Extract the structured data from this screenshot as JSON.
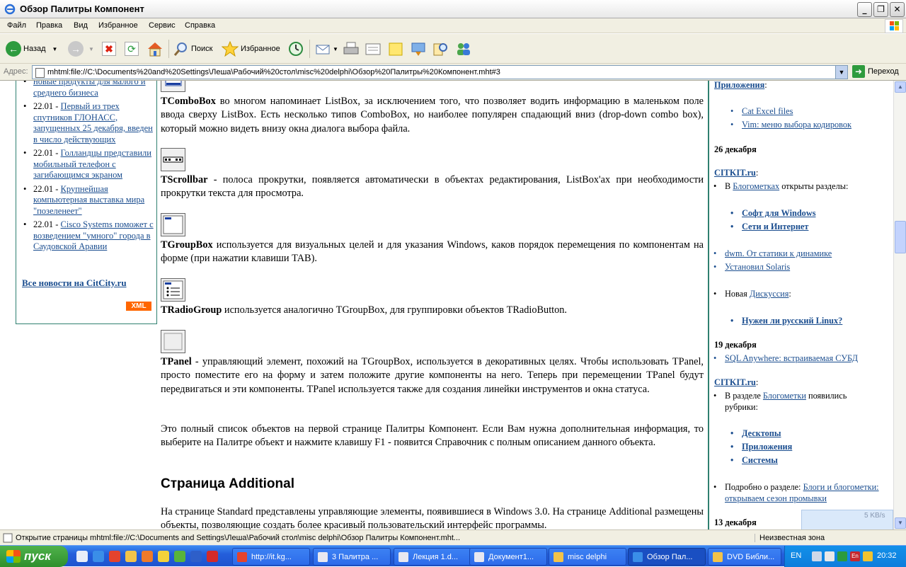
{
  "window": {
    "title": "Обзор Палитры Компонент",
    "buttons": {
      "minimize": "_",
      "maximize": "❐",
      "close": "✕"
    }
  },
  "menu": [
    "Файл",
    "Правка",
    "Вид",
    "Избранное",
    "Сервис",
    "Справка"
  ],
  "toolbar": {
    "back_label": "Назад",
    "search_label": "Поиск",
    "favorites_label": "Избранное"
  },
  "address": {
    "label": "Адрес:",
    "url": "mhtml:file://C:\\Documents%20and%20Settings\\Леша\\Рабочий%20стол\\misc%20delphi\\Обзор%20Палитры%20Компонент.mht#3",
    "go_label": "Переход"
  },
  "left_news": {
    "items": [
      {
        "date": "",
        "link": "новые продукты для малого и среднего бизнеса"
      },
      {
        "date": "22.01 - ",
        "link": "Первый из трех спутников ГЛОНАСС, запущенных 25 декабря, введен в число действующих"
      },
      {
        "date": "22.01 - ",
        "link": "Голландцы представили мобильный телефон с загибающимся экраном"
      },
      {
        "date": "22.01 - ",
        "link": "Крупнейшая компьютерная выставка мира \"позеленеет\""
      },
      {
        "date": "22.01 - ",
        "link": "Cisco Systems поможет с возведением \"умного\" города в Саудовской Аравии"
      }
    ],
    "all_news": "Все новости на CitCity.ru",
    "xml_badge": "XML"
  },
  "main": {
    "combo": {
      "term": "TComboBox",
      "text": " во многом напоминает ListBox, за исключением того, что позволяет водить информацию в маленьком поле ввода сверху ListBox. Есть несколько типов ComboBox, но наиболее популярен спадающий вниз (drop-down combo box), который можно видеть внизу окна диалога выбора файла."
    },
    "scrollbar": {
      "term": "TScrollbar",
      "text": " - полоса прокрутки, появляется автоматически в объектах редактирования, ListBox'ах при необходимости прокрутки текста для просмотра."
    },
    "groupbox": {
      "term": "TGroupBox",
      "text": " используется для визуальных целей и для указания Windows, каков порядок перемещения по компонентам на форме (при нажатии клавиши TAB)."
    },
    "radiogroup": {
      "term": "TRadioGroup",
      "text": " используется аналогично TGroupBox, для группировки объектов TRadioButton."
    },
    "panel": {
      "term": "TPanel",
      "text": " - управляющий элемент, похожий на TGroupBox, используется в декоративных целях. Чтобы использовать TPanel, просто поместите его на форму и затем положите другие компоненты на него. Теперь при перемещении TPanel будут передвигаться и эти компоненты. TPanel используется также для создания линейки инструментов и окна статуса."
    },
    "summary": "Это полный список объектов на первой странице Палитры Компонент. Если Вам нужна дополнительная информация, то выберите на Палитре объект и нажмите клавишу F1 - появится Справочник с полным описанием данного объекта.",
    "heading": "Страница Additional",
    "additional": "На странице Standard представлены управляющие элементы, появившиеся в Windows 3.0. На странице Additional размещены объекты, позволяющие создать более красивый пользовательский интерфейс программы."
  },
  "right": {
    "top_link": "Приложения",
    "top_items": [
      "Cat Excel files",
      "Vim: меню выбора кодировок"
    ],
    "date1": "26 декабря",
    "site1": "CITKIT.ru",
    "blog_line_pre": "В ",
    "blog_link": "Блогометках",
    "blog_line_post": " открыты разделы:",
    "sections1": [
      "Софт для Windows",
      "Сети и Интернет"
    ],
    "items2": [
      "dwm. От статики к динамике",
      "Установил Solaris"
    ],
    "discuss_pre": "Новая ",
    "discuss_link": "Дискуссия",
    "discuss_item": "Нужен ли русский Linux?",
    "date2": "19 декабря",
    "sql_item": "SQL Anywhere: встраиваемая СУБД",
    "site2": "CITKIT.ru",
    "rubric_pre": "В разделе ",
    "rubric_link": "Блогометки",
    "rubric_post": " появились рубрики:",
    "rubrics": [
      "Десктопы",
      "Приложения",
      "Системы"
    ],
    "detail_pre": "Подробно о разделе: ",
    "detail_link": "Блоги и блогометки: открываем сезон промывки",
    "date3": "13 декабря"
  },
  "status": {
    "text": "Открытие страницы mhtml:file://C:\\Documents and Settings\\Леша\\Рабочий стол\\misc delphi\\Обзор Палитры Компонент.mht...",
    "zone": "Неизвестная зона",
    "speed": "5 KB/s"
  },
  "taskbar": {
    "start_label": "пуск",
    "tasks": [
      "http://it.kg...",
      "3 Палитра ...",
      "Лекция 1.d...",
      "Документ1...",
      "misc delphi",
      "Обзор Пал...",
      "DVD Библи..."
    ],
    "language": "EN",
    "clock": "20:32"
  }
}
